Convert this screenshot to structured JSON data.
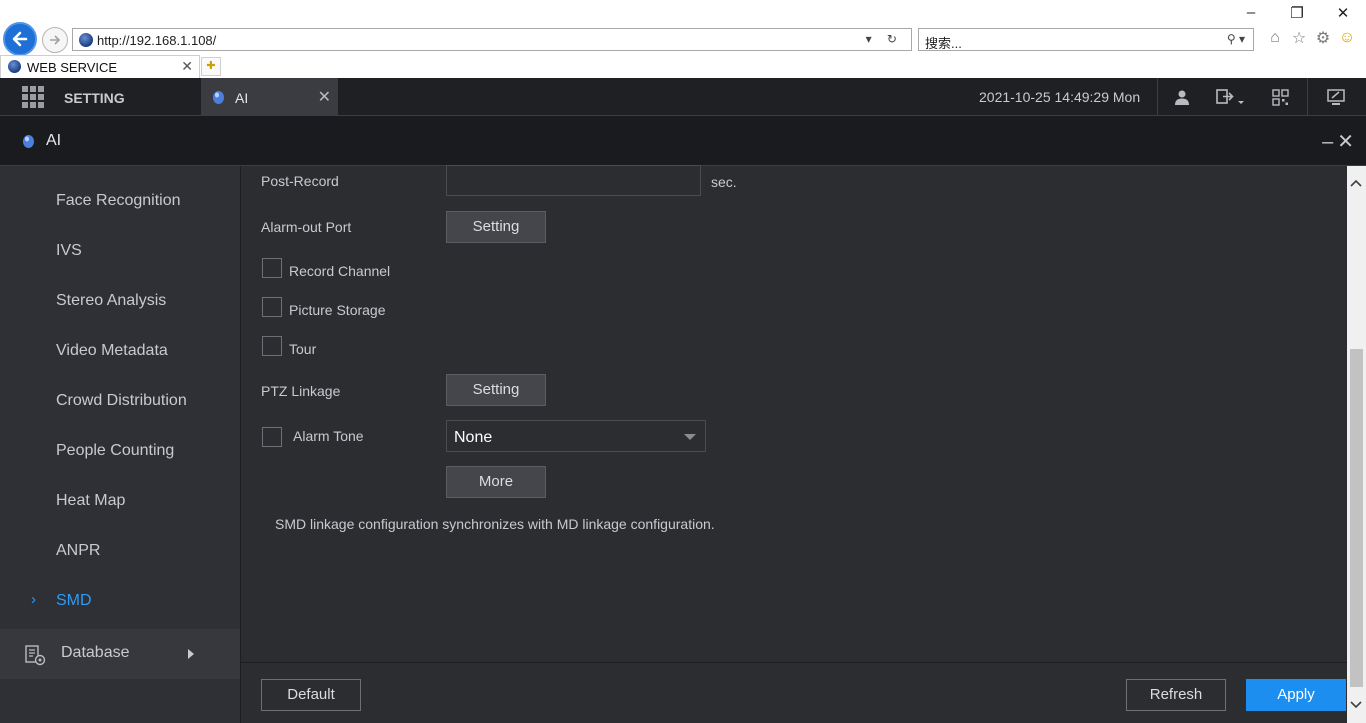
{
  "browser": {
    "url": "http://192.168.1.108/",
    "search_placeholder": "搜索...",
    "tab_title": "WEB SERVICE"
  },
  "topbar": {
    "menu_label": "SETTING",
    "active_tab": "AI",
    "datetime": "2021-10-25 14:49:29 Mon"
  },
  "window": {
    "title": "AI"
  },
  "sidebar": {
    "items": [
      {
        "label": "Face Recognition"
      },
      {
        "label": "IVS"
      },
      {
        "label": "Stereo Analysis"
      },
      {
        "label": "Video Metadata"
      },
      {
        "label": "Crowd Distribution"
      },
      {
        "label": "People Counting"
      },
      {
        "label": "Heat Map"
      },
      {
        "label": "ANPR"
      },
      {
        "label": "SMD",
        "active": true
      }
    ],
    "database_label": "Database"
  },
  "form": {
    "post_record_label": "Post-Record",
    "post_record_value": "",
    "post_record_unit": "sec.",
    "alarm_out_label": "Alarm-out Port",
    "setting_button": "Setting",
    "record_channel_label": "Record Channel",
    "record_channel_checked": false,
    "picture_storage_label": "Picture Storage",
    "picture_storage_checked": false,
    "tour_label": "Tour",
    "tour_checked": false,
    "ptz_linkage_label": "PTZ Linkage",
    "alarm_tone_label": "Alarm Tone",
    "alarm_tone_checked": false,
    "alarm_tone_value": "None",
    "more_button": "More",
    "note": "SMD linkage configuration synchronizes with MD linkage configuration."
  },
  "footer": {
    "default_button": "Default",
    "refresh_button": "Refresh",
    "apply_button": "Apply"
  },
  "colors": {
    "accent": "#1b8ef0",
    "active_text": "#2d9cf5",
    "background": "#2b2d31"
  }
}
